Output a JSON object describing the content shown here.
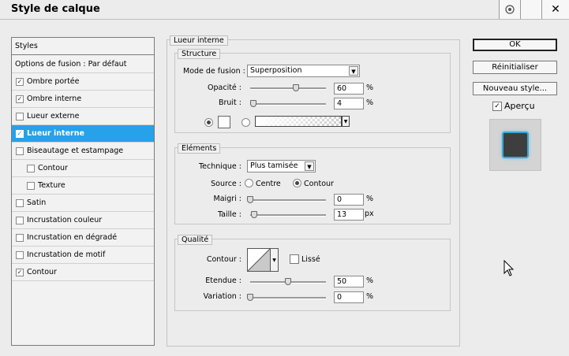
{
  "window": {
    "title": "Style de calque",
    "icons": [
      "settings-icon",
      "minimize-icon",
      "close-icon"
    ],
    "close_glyph": "✕"
  },
  "styles_panel": {
    "header": "Styles",
    "blending_options": "Options de fusion : Par défaut",
    "items": [
      {
        "label": "Ombre portée",
        "checked": true,
        "selected": false,
        "indent": false
      },
      {
        "label": "Ombre interne",
        "checked": true,
        "selected": false,
        "indent": false
      },
      {
        "label": "Lueur externe",
        "checked": false,
        "selected": false,
        "indent": false
      },
      {
        "label": "Lueur interne",
        "checked": true,
        "selected": true,
        "indent": false
      },
      {
        "label": "Biseautage et estampage",
        "checked": false,
        "selected": false,
        "indent": false
      },
      {
        "label": "Contour",
        "checked": false,
        "selected": false,
        "indent": true
      },
      {
        "label": "Texture",
        "checked": false,
        "selected": false,
        "indent": true
      },
      {
        "label": "Satin",
        "checked": false,
        "selected": false,
        "indent": false
      },
      {
        "label": "Incrustation couleur",
        "checked": false,
        "selected": false,
        "indent": false
      },
      {
        "label": "Incrustation en dégradé",
        "checked": false,
        "selected": false,
        "indent": false
      },
      {
        "label": "Incrustation de motif",
        "checked": false,
        "selected": false,
        "indent": false
      },
      {
        "label": "Contour",
        "checked": true,
        "selected": false,
        "indent": false
      }
    ]
  },
  "inner_glow": {
    "title": "Lueur interne",
    "structure": {
      "title": "Structure",
      "blend_mode_label": "Mode de fusion :",
      "blend_mode_value": "Superposition",
      "opacity_label": "Opacité :",
      "opacity_value": "60",
      "opacity_unit": "%",
      "opacity_fraction": 0.6,
      "noise_label": "Bruit :",
      "noise_value": "4",
      "noise_unit": "%",
      "noise_fraction": 0.04,
      "color_radio_selected": "color",
      "swatch_color": "#ffffff"
    },
    "elements": {
      "title": "Eléments",
      "technique_label": "Technique :",
      "technique_value": "Plus tamisée",
      "source_label": "Source :",
      "source_center": "Centre",
      "source_edge": "Contour",
      "source_selected": "edge",
      "choke_label": "Maigri :",
      "choke_value": "0",
      "choke_unit": "%",
      "choke_fraction": 0.0,
      "size_label": "Taille :",
      "size_value": "13",
      "size_unit": "px",
      "size_fraction": 0.052
    },
    "quality": {
      "title": "Qualité",
      "contour_label": "Contour :",
      "antialias_label": "Lissé",
      "antialias_checked": false,
      "range_label": "Etendue :",
      "range_value": "50",
      "range_unit": "%",
      "range_fraction": 0.5,
      "jitter_label": "Variation :",
      "jitter_value": "0",
      "jitter_unit": "%",
      "jitter_fraction": 0.0
    }
  },
  "buttons": {
    "ok": "OK",
    "reset": "Réinitialiser",
    "new_style": "Nouveau style...",
    "preview_label": "Aperçu",
    "preview_checked": true
  },
  "colors": {
    "selection": "#27a1e8",
    "preview_glow": "#3aa7d6"
  }
}
